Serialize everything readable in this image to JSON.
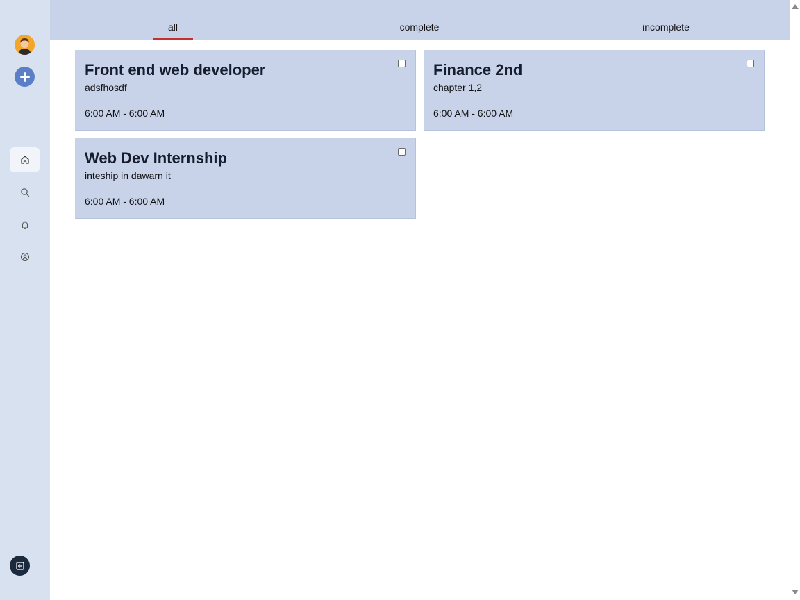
{
  "sidebar": {
    "avatar_icon": "user-avatar",
    "add_icon": "plus-icon",
    "nav": [
      {
        "name": "home",
        "icon": "home-icon",
        "active": true
      },
      {
        "name": "search",
        "icon": "search-icon",
        "active": false
      },
      {
        "name": "notifications",
        "icon": "bell-icon",
        "active": false
      },
      {
        "name": "profile",
        "icon": "user-circle-icon",
        "active": false
      }
    ],
    "logout_icon": "logout-icon"
  },
  "tabs": [
    {
      "label": "all",
      "active": true
    },
    {
      "label": "complete",
      "active": false
    },
    {
      "label": "incomplete",
      "active": false
    }
  ],
  "tasks": [
    {
      "title": "Front end web developer",
      "description": "adsfhosdf",
      "time": "6:00 AM - 6:00 AM",
      "checked": false
    },
    {
      "title": "Finance 2nd",
      "description": "chapter 1,2",
      "time": "6:00 AM - 6:00 AM",
      "checked": false
    },
    {
      "title": "Web Dev Internship",
      "description": "inteship in dawarn it",
      "time": "6:00 AM - 6:00 AM",
      "checked": false
    }
  ],
  "colors": {
    "sidebar_bg": "#d8e1f0",
    "card_bg": "#c8d3ea",
    "accent": "#5b7fc7",
    "active_tab_underline": "#c53030",
    "dark": "#1c2a3e"
  }
}
